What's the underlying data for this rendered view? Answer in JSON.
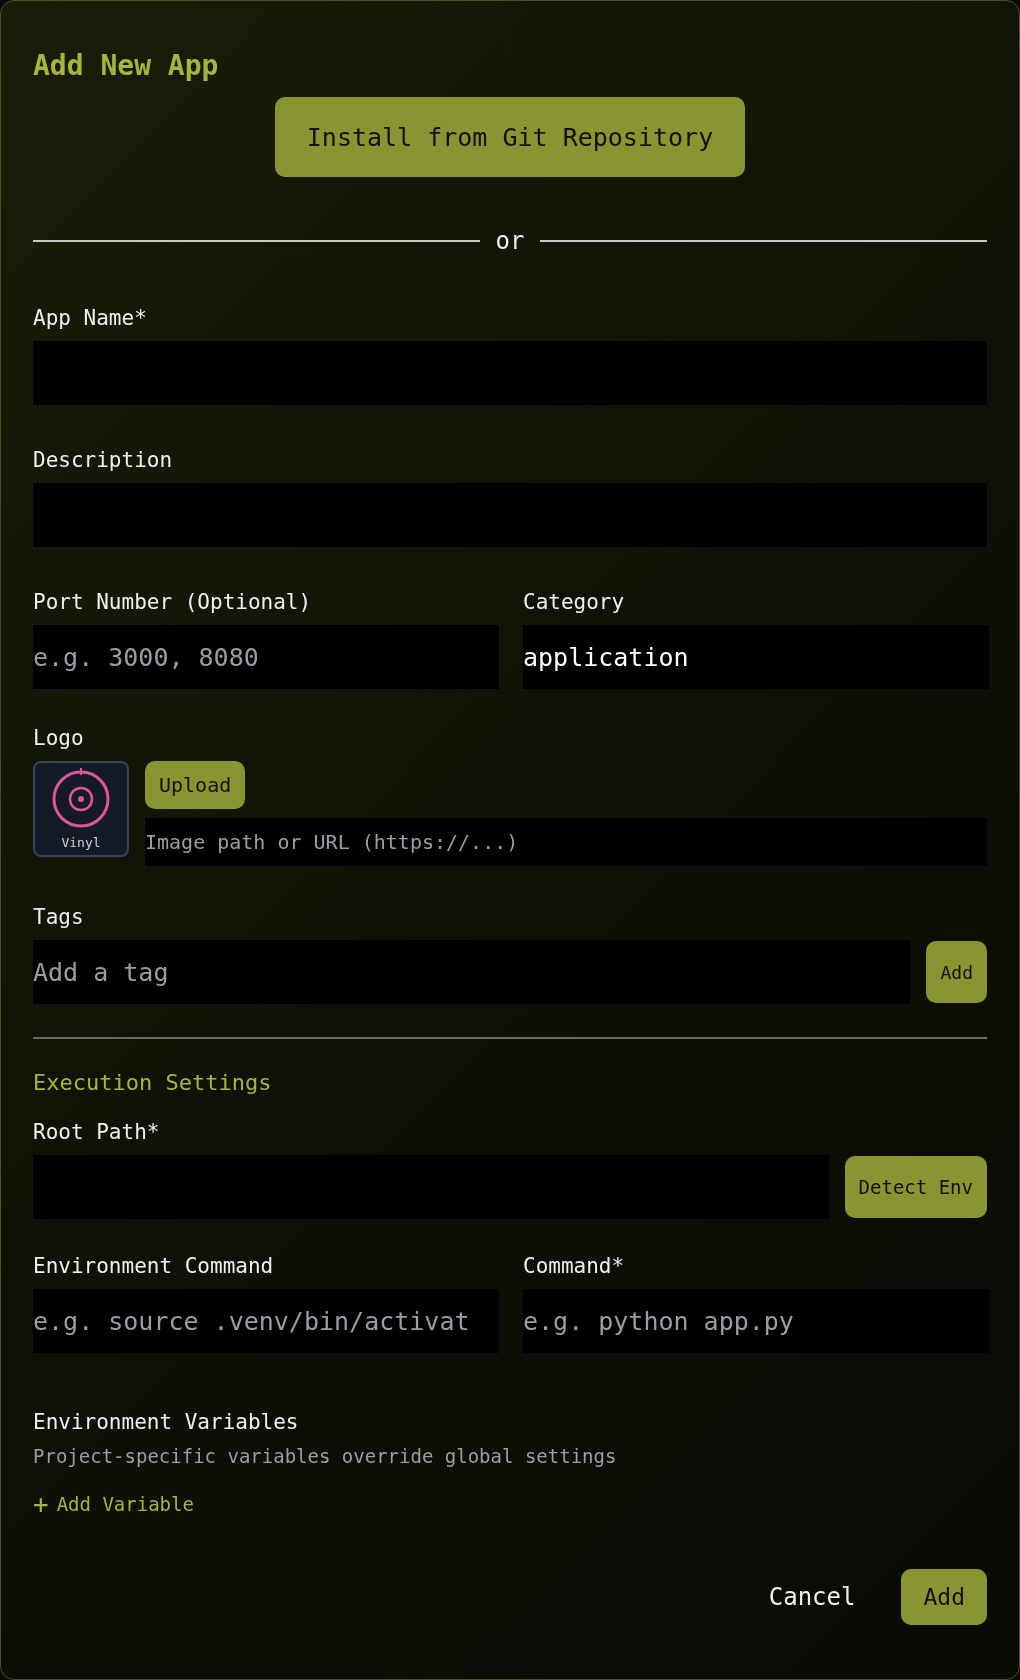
{
  "dialog": {
    "title": "Add New App"
  },
  "git_button": "Install from Git Repository",
  "divider_text": "or",
  "app_name": {
    "label": "App Name*"
  },
  "description": {
    "label": "Description"
  },
  "port": {
    "label": "Port Number (Optional)",
    "placeholder": "e.g. 3000, 8080"
  },
  "category": {
    "label": "Category",
    "value": "application"
  },
  "logo": {
    "label": "Logo",
    "preview_caption": "Vinyl",
    "upload_button": "Upload",
    "url_placeholder": "Image path or URL (https://...)"
  },
  "tags": {
    "label": "Tags",
    "placeholder": "Add a tag",
    "add_button": "Add"
  },
  "execution": {
    "heading": "Execution Settings",
    "root_path": {
      "label": "Root Path*",
      "button": "Detect Env"
    },
    "env_command": {
      "label": "Environment Command",
      "placeholder": "e.g. source .venv/bin/activat"
    },
    "command": {
      "label": "Command*",
      "placeholder": "e.g. python app.py"
    },
    "env_vars": {
      "label": "Environment Variables",
      "hint": "Project-specific variables override global settings",
      "add_link_icon": "+",
      "add_link": "Add Variable"
    }
  },
  "footer": {
    "cancel": "Cancel",
    "submit": "Add"
  }
}
